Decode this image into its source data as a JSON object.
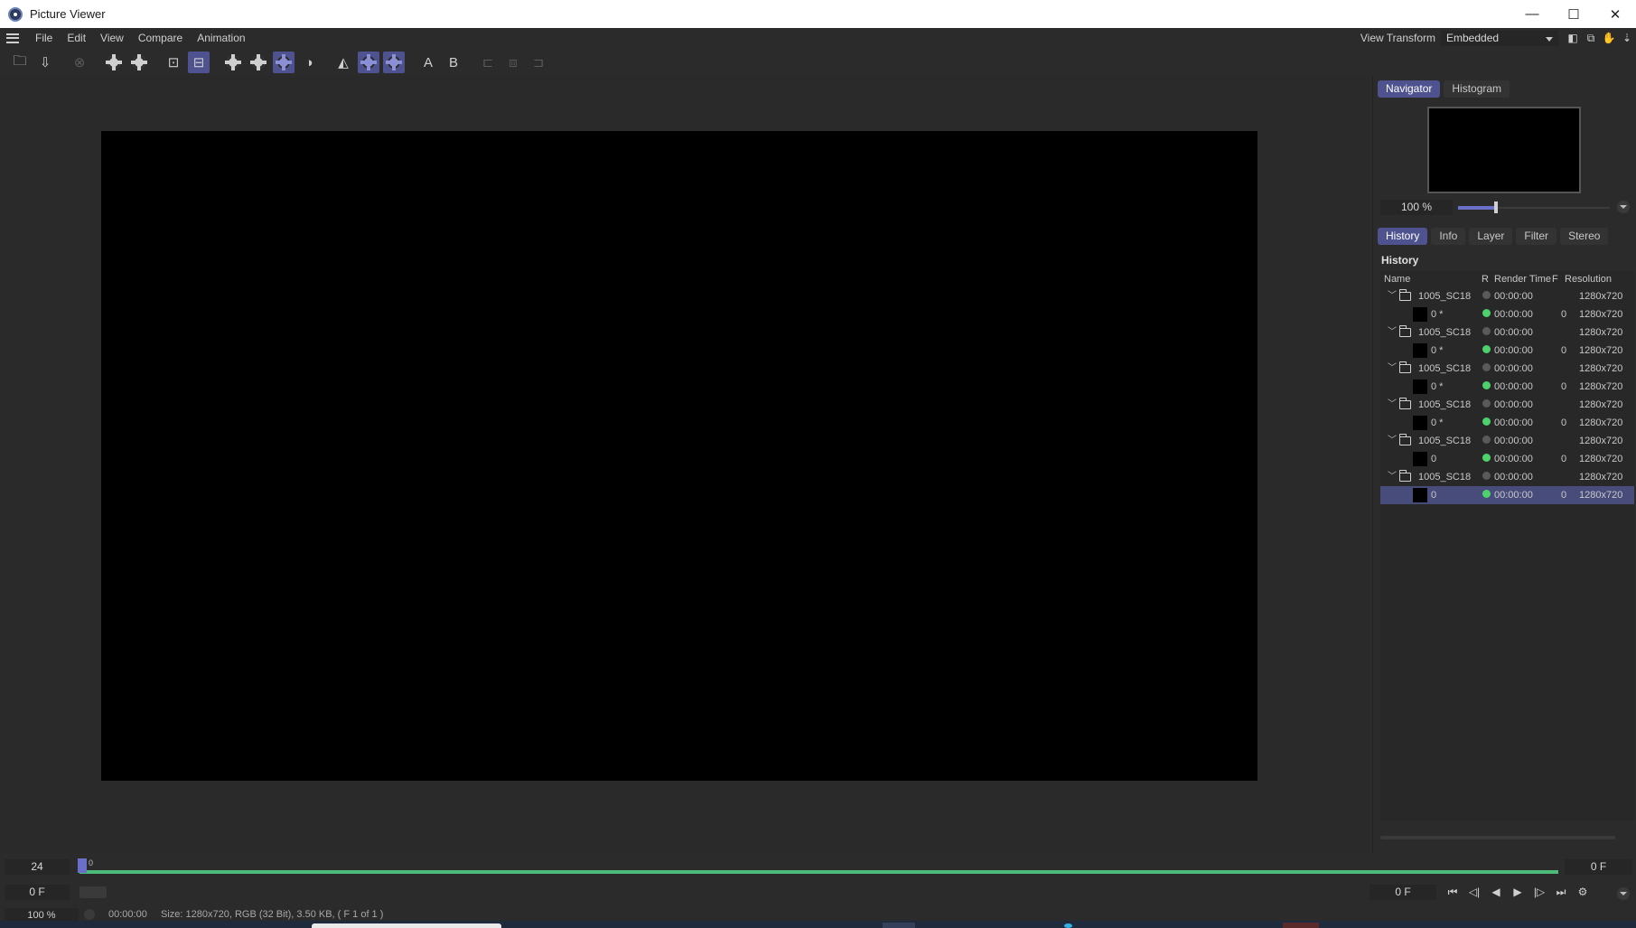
{
  "window": {
    "title": "Picture Viewer",
    "minimize": "—",
    "maximize": "☐",
    "close": "✕"
  },
  "menu": {
    "items": [
      "File",
      "Edit",
      "View",
      "Compare",
      "Animation"
    ],
    "view_transform_label": "View Transform",
    "view_transform_value": "Embedded"
  },
  "toolbar": {
    "icons": [
      "open-folder-icon",
      "save-icon",
      "stop-render-icon",
      "gear-icon",
      "gear-icon",
      "fit-frame-icon",
      "fit-screen-icon",
      "gear-icon",
      "gear-icon",
      "gear-icon",
      "contrast-icon",
      "compare-swap-icon",
      "gear-icon",
      "gear-icon",
      "A",
      "B",
      "compare-icon",
      "compare-icon",
      "compare-icon"
    ],
    "a_label": "A",
    "b_label": "B"
  },
  "navigator": {
    "tabs": [
      "Navigator",
      "Histogram"
    ],
    "active_tab": "Navigator",
    "zoom": "100 %",
    "zoom_slider_fraction": 0.25
  },
  "history": {
    "tabs": [
      "History",
      "Info",
      "Layer",
      "Filter",
      "Stereo"
    ],
    "active_tab": "History",
    "heading": "History",
    "columns": {
      "name": "Name",
      "r": "R",
      "render_time": "Render Time",
      "f": "F",
      "resolution": "Resolution"
    },
    "groups": [
      {
        "name": "1005_SC18",
        "time": "00:00:00",
        "res": "1280x720",
        "item": {
          "name": "0 *",
          "time": "00:00:00",
          "f": "0",
          "res": "1280x720"
        }
      },
      {
        "name": "1005_SC18",
        "time": "00:00:00",
        "res": "1280x720",
        "item": {
          "name": "0 *",
          "time": "00:00:00",
          "f": "0",
          "res": "1280x720"
        }
      },
      {
        "name": "1005_SC18",
        "time": "00:00:00",
        "res": "1280x720",
        "item": {
          "name": "0 *",
          "time": "00:00:00",
          "f": "0",
          "res": "1280x720"
        }
      },
      {
        "name": "1005_SC18",
        "time": "00:00:00",
        "res": "1280x720",
        "item": {
          "name": "0 *",
          "time": "00:00:00",
          "f": "0",
          "res": "1280x720"
        }
      },
      {
        "name": "1005_SC18",
        "time": "00:00:00",
        "res": "1280x720",
        "item": {
          "name": "0",
          "time": "00:00:00",
          "f": "0",
          "res": "1280x720"
        }
      },
      {
        "name": "1005_SC18",
        "time": "00:00:00",
        "res": "1280x720",
        "item": {
          "name": "0",
          "time": "00:00:00",
          "f": "0",
          "res": "1280x720",
          "selected": true
        }
      }
    ]
  },
  "timeline": {
    "fps": "24",
    "start_frame": "0 F",
    "marker": "0",
    "end_frame": "0 F",
    "current_frame": "0 F"
  },
  "status": {
    "zoom": "100 %",
    "time": "00:00:00",
    "info": "Size: 1280x720, RGB (32 Bit), 3.50 KB,  ( F 1 of 1 )"
  },
  "colors": {
    "accent": "#4e528f",
    "progress": "#4dbb7a",
    "status_ok": "#4dd26b"
  }
}
